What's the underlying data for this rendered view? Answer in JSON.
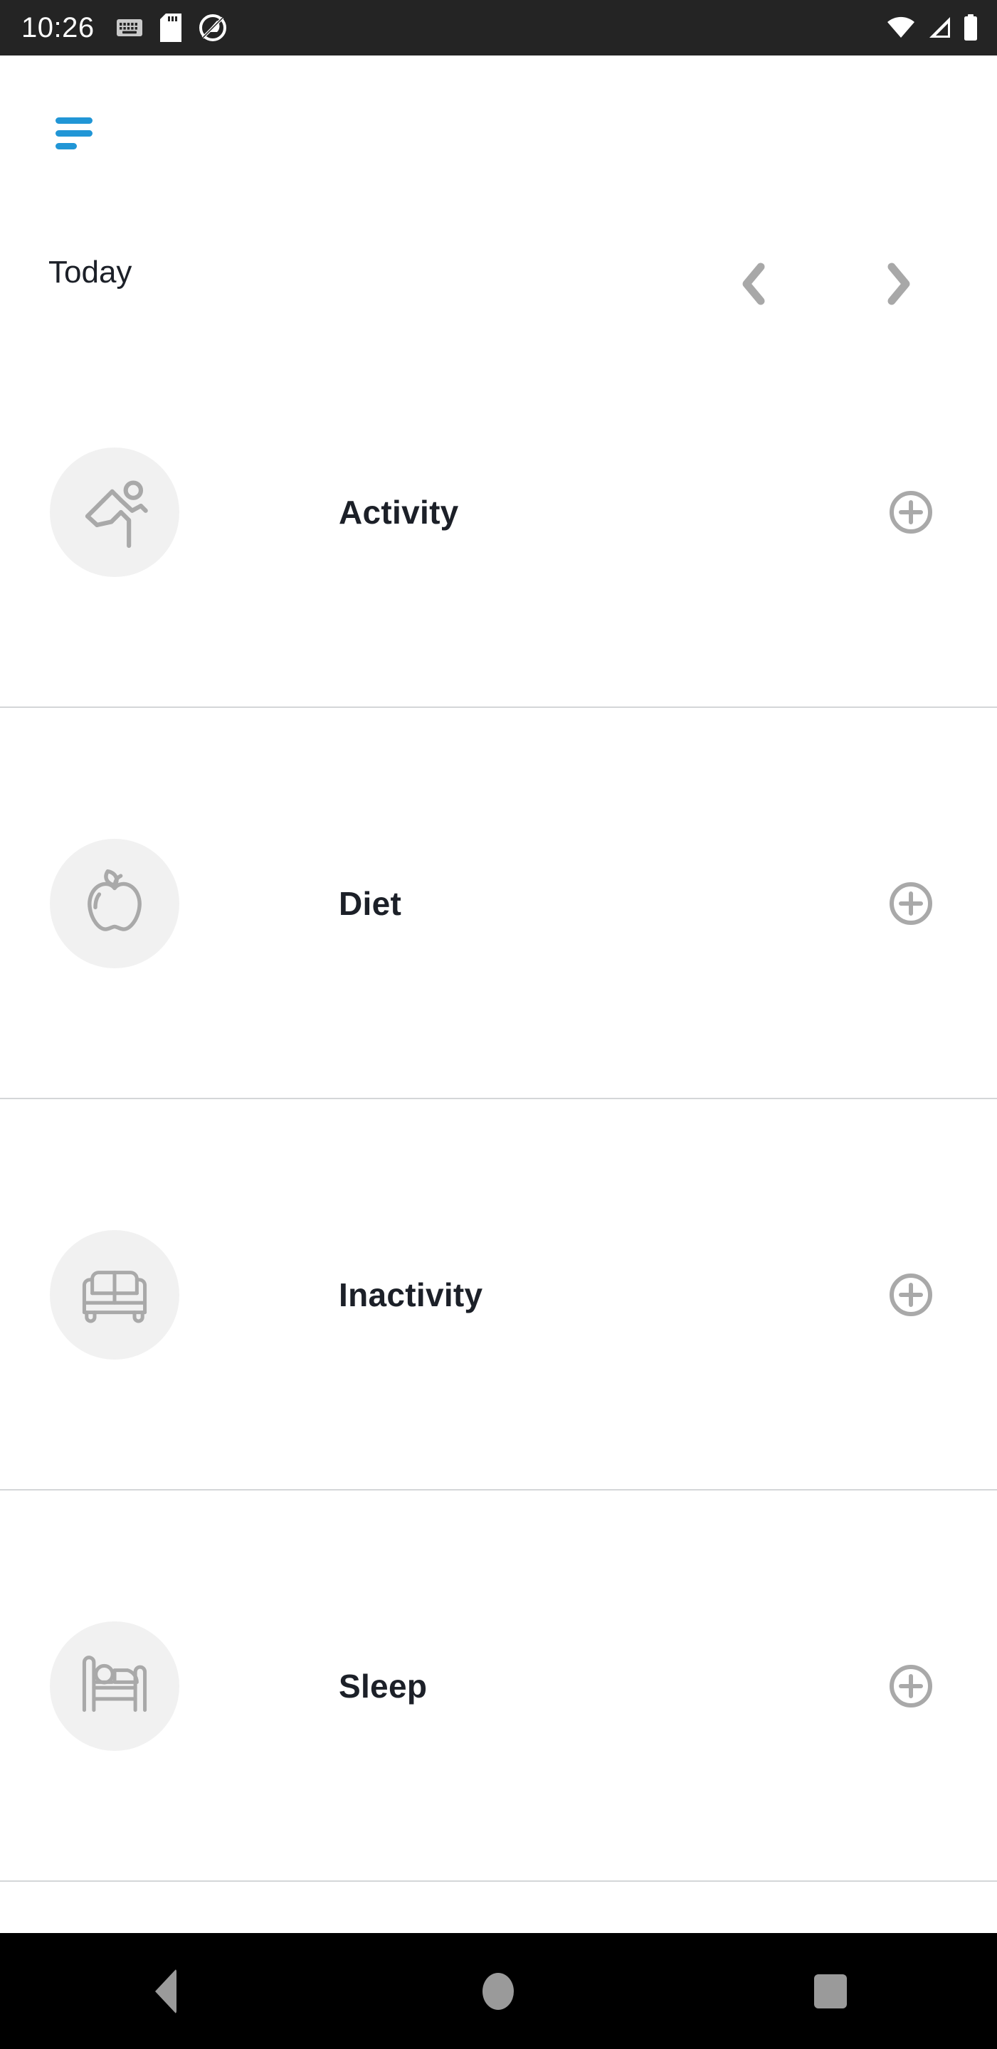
{
  "status_bar": {
    "time": "10:26",
    "left_icons": [
      "keyboard-icon",
      "sd-card-icon",
      "android-q-icon"
    ],
    "right_icons": [
      "wifi-icon",
      "cellular-signal-icon",
      "battery-icon"
    ],
    "background_color": "#242424",
    "foreground_color": "#ffffff"
  },
  "top_bar": {
    "menu_button": "hamburger-menu-icon",
    "menu_color": "#2196d6"
  },
  "date_nav": {
    "label": "Today",
    "prev_icon": "chevron-left-icon",
    "next_icon": "chevron-right-icon",
    "chevron_color": "#a8a8a8"
  },
  "list": {
    "items": [
      {
        "label": "Activity",
        "icon": "running-person-icon",
        "add_icon": "plus-circle-icon"
      },
      {
        "label": "Diet",
        "icon": "apple-icon",
        "add_icon": "plus-circle-icon"
      },
      {
        "label": "Inactivity",
        "icon": "sofa-icon",
        "add_icon": "plus-circle-icon"
      },
      {
        "label": "Sleep",
        "icon": "bed-icon",
        "add_icon": "plus-circle-icon"
      }
    ],
    "icon_circle_color": "#f1f1f1",
    "icon_stroke_color": "#a9a9a9",
    "label_color": "#1c2028",
    "divider_color": "#d4d6d8"
  },
  "bottom_nav": {
    "back": "back-triangle-icon",
    "home": "home-circle-icon",
    "recents": "recents-square-icon",
    "background_color": "#000000",
    "icon_color": "#9a9a9a"
  }
}
